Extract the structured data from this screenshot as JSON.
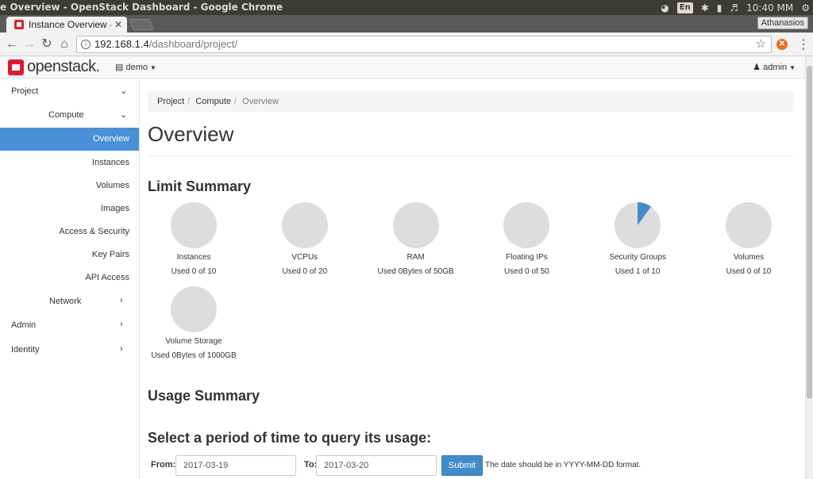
{
  "os": {
    "window_title": "e Overview - OpenStack Dashboard - Google Chrome",
    "lang": "En",
    "clock": "10:40 MM"
  },
  "browser": {
    "tab_title": "Instance Overview - ",
    "profile": "Athanasios",
    "url_host": "192.168.1.4",
    "url_path": "/dashboard/project/"
  },
  "header": {
    "logo": "openstack.",
    "project": "demo",
    "user": "admin"
  },
  "sidebar": {
    "project": "Project",
    "compute": "Compute",
    "active": "Overview",
    "items": [
      "Instances",
      "Volumes",
      "Images",
      "Access & Security",
      "Key Pairs",
      "API Access"
    ],
    "network": "Network",
    "admin": "Admin",
    "identity": "Identity"
  },
  "main": {
    "breadcrumb": [
      "Project",
      "Compute",
      "Overview"
    ],
    "title": "Overview",
    "limit_title": "Limit Summary",
    "usage_title": "Usage Summary",
    "query_title": "Select a period of time to query its usage:",
    "from_label": "From:",
    "to_label": "To:",
    "from_value": "2017-03-19",
    "to_value": "2017-03-20",
    "submit": "Submit",
    "help": "The date should be in YYYY-MM-DD format."
  },
  "limits": [
    {
      "label": "Instances",
      "usage": "Used 0 of 10",
      "used": 0,
      "total": 10
    },
    {
      "label": "VCPUs",
      "usage": "Used 0 of 20",
      "used": 0,
      "total": 20
    },
    {
      "label": "RAM",
      "usage": "Used 0Bytes of 50GB",
      "used": 0,
      "total": 50
    },
    {
      "label": "Floating IPs",
      "usage": "Used 0 of 50",
      "used": 0,
      "total": 50
    },
    {
      "label": "Security Groups",
      "usage": "Used 1 of 10",
      "used": 1,
      "total": 10
    },
    {
      "label": "Volumes",
      "usage": "Used 0 of 10",
      "used": 0,
      "total": 10
    },
    {
      "label": "Volume Storage",
      "usage": "Used 0Bytes of 1000GB",
      "used": 0,
      "total": 1000
    }
  ],
  "colors": {
    "pie_bg": "#dddddd",
    "pie_fill": "#428bca",
    "accent": "#4a90d9"
  }
}
